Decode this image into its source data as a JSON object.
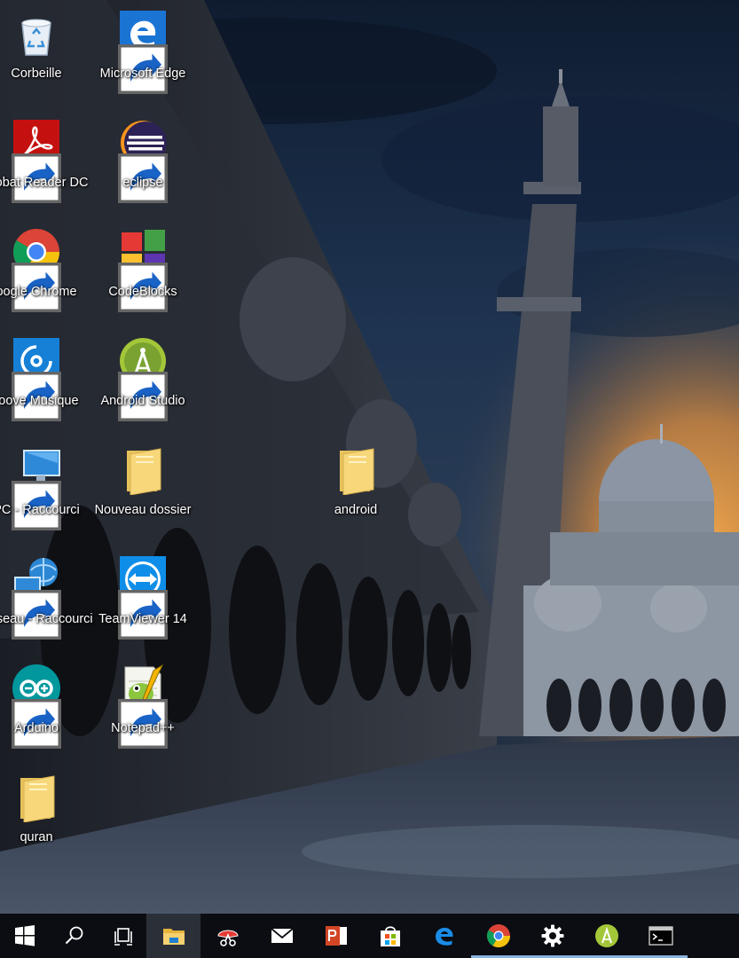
{
  "desktop_icons": [
    {
      "label": "Corbeille",
      "icon": "recycle-bin-icon",
      "shortcut": false
    },
    {
      "label": "Microsoft Edge",
      "icon": "edge-icon",
      "shortcut": true
    },
    {
      "label": "crobat Reader DC",
      "icon": "acrobat-reader-icon",
      "shortcut": true
    },
    {
      "label": "eclipse",
      "icon": "eclipse-icon",
      "shortcut": true
    },
    {
      "label": "oogle Chrome",
      "icon": "chrome-icon",
      "shortcut": true
    },
    {
      "label": "CodeBlocks",
      "icon": "codeblocks-icon",
      "shortcut": true
    },
    {
      "label": "roove Musique",
      "icon": "groove-music-icon",
      "shortcut": true
    },
    {
      "label": "Android Studio",
      "icon": "android-studio-icon",
      "shortcut": true
    },
    {
      "label": "PC - Raccourci",
      "icon": "this-pc-icon",
      "shortcut": true
    },
    {
      "label": "Nouveau dossier",
      "icon": "folder-icon",
      "shortcut": false
    },
    {
      "label": "android",
      "icon": "folder-icon",
      "shortcut": false
    },
    {
      "label": "Réseau - Raccourci",
      "icon": "network-icon",
      "shortcut": true
    },
    {
      "label": "TeamViewer 14",
      "icon": "teamviewer-icon",
      "shortcut": true
    },
    {
      "label": "Arduino",
      "icon": "arduino-icon",
      "shortcut": true
    },
    {
      "label": "Notepad++",
      "icon": "notepad-plus-plus-icon",
      "shortcut": true
    },
    {
      "label": "quran",
      "icon": "folder-icon",
      "shortcut": false
    }
  ],
  "taskbar": {
    "items": [
      {
        "icon": "start-windows-icon",
        "active": false,
        "running": false
      },
      {
        "icon": "search-icon",
        "active": false,
        "running": false
      },
      {
        "icon": "task-view-icon",
        "active": false,
        "running": false
      },
      {
        "icon": "file-explorer-icon",
        "active": true,
        "running": false
      },
      {
        "icon": "snipping-tool-icon",
        "active": false,
        "running": false
      },
      {
        "icon": "mail-icon",
        "active": false,
        "running": false
      },
      {
        "icon": "powerpoint-icon",
        "active": false,
        "running": false
      },
      {
        "icon": "store-icon",
        "active": false,
        "running": false
      },
      {
        "icon": "edge-icon",
        "active": false,
        "running": false
      },
      {
        "icon": "chrome-icon",
        "active": false,
        "running": true
      },
      {
        "icon": "settings-gear-icon",
        "active": false,
        "running": true
      },
      {
        "icon": "android-studio-icon",
        "active": false,
        "running": true
      },
      {
        "icon": "command-prompt-icon",
        "active": false,
        "running": true
      }
    ]
  },
  "colors": {
    "taskbar": "#0b0d12",
    "taskbar_active": "#2b2f38",
    "running_indicator": "#8bb3e0",
    "label_text": "#ffffff"
  }
}
